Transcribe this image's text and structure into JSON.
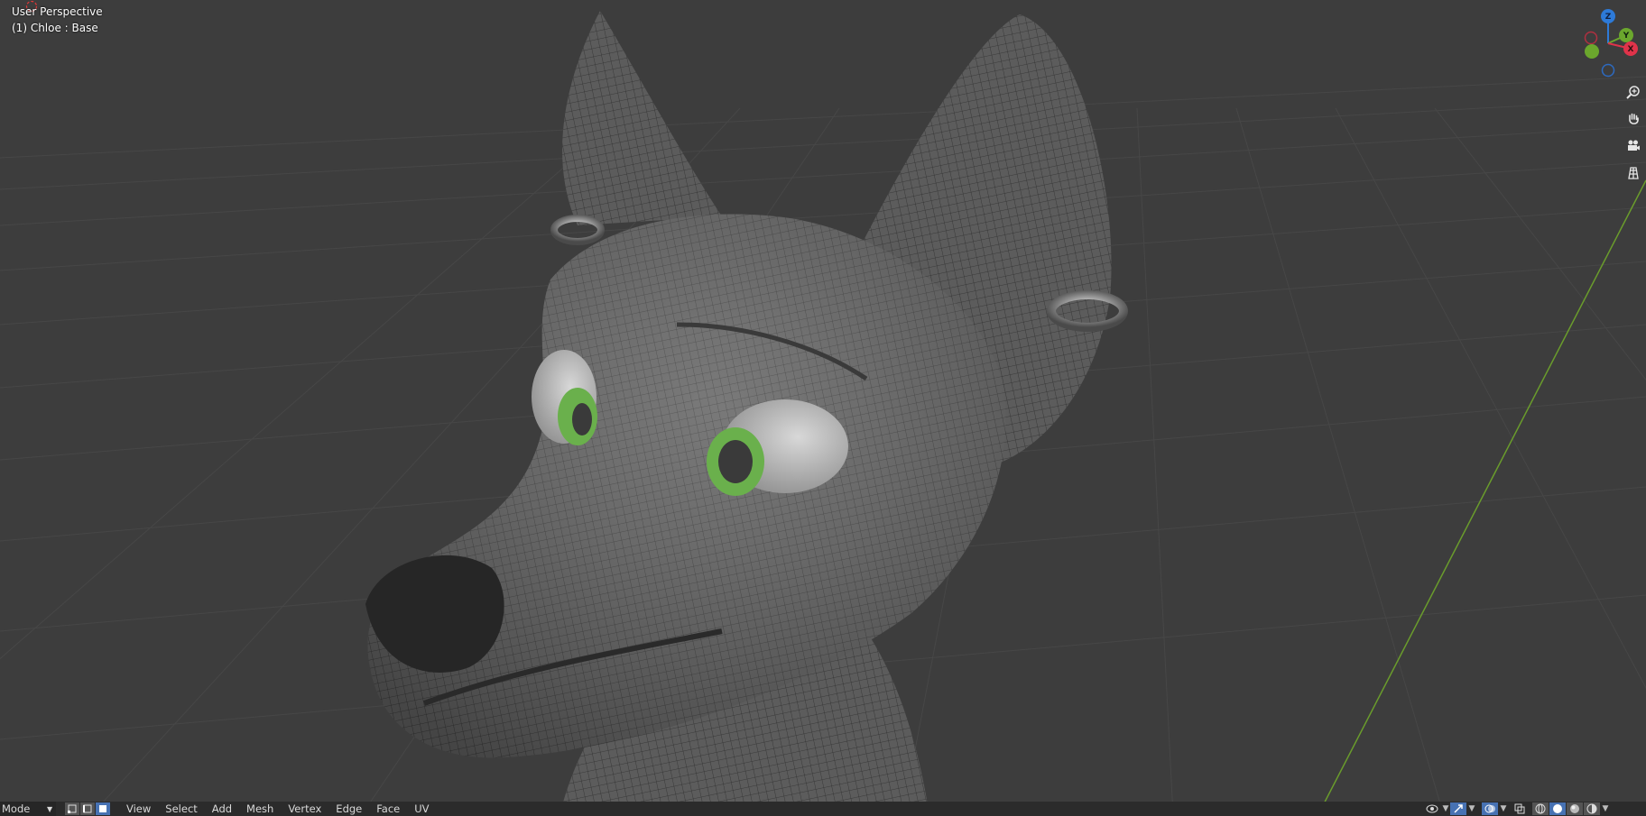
{
  "viewport": {
    "view_name": "User Perspective",
    "object_name": "(1) Chloe : Base",
    "colors": {
      "background": "#3d3d3d",
      "grid": "#474747",
      "y_axis": "#6a9c2c",
      "mesh": "#585858",
      "wire": "#2f2f2f",
      "iris": "#6ab04c"
    }
  },
  "gizmo": {
    "z": "Z",
    "y": "Y",
    "x": "X",
    "colors": {
      "x": "#e0334a",
      "y": "#6ba72d",
      "z": "#2d7ad8"
    }
  },
  "navigation": {
    "icons": [
      "zoom-icon",
      "hand-pan-icon",
      "camera-icon",
      "ortho-grid-icon"
    ]
  },
  "header": {
    "mode": "Mode",
    "menus": {
      "view": "View",
      "select": "Select",
      "add": "Add",
      "mesh": "Mesh",
      "vertex": "Vertex",
      "edge": "Edge",
      "face": "Face",
      "uv": "UV"
    }
  }
}
